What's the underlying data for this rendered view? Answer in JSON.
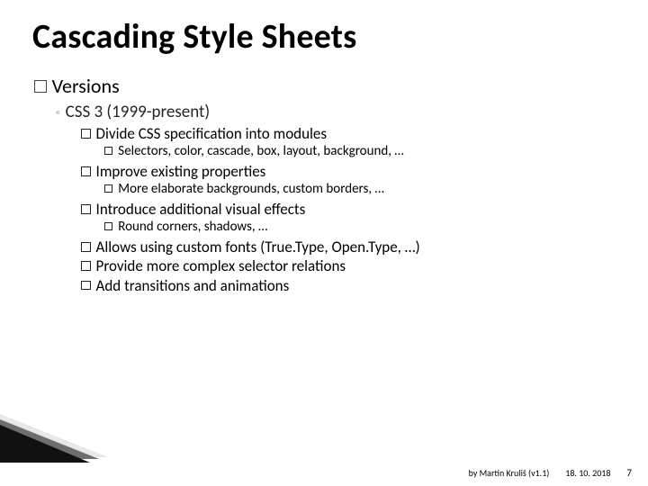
{
  "title": "Cascading Style Sheets",
  "h1": "Versions",
  "h2": "CSS 3 (1999-present)",
  "items": [
    {
      "h3": "Divide CSS specification into modules",
      "h4": "Selectors, color, cascade, box, layout, background, …"
    },
    {
      "h3": "Improve existing properties",
      "h4": "More elaborate backgrounds, custom borders, …"
    },
    {
      "h3": "Introduce additional visual effects",
      "h4": "Round corners, shadows, …"
    },
    {
      "h3": "Allows using custom fonts (True.Type, Open.Type, …)"
    },
    {
      "h3": "Provide more complex selector relations"
    },
    {
      "h3": "Add transitions and animations"
    }
  ],
  "footer": {
    "author": "by Martin Kruliš (v1.1)",
    "date": "18. 10. 2018",
    "page": "7"
  }
}
